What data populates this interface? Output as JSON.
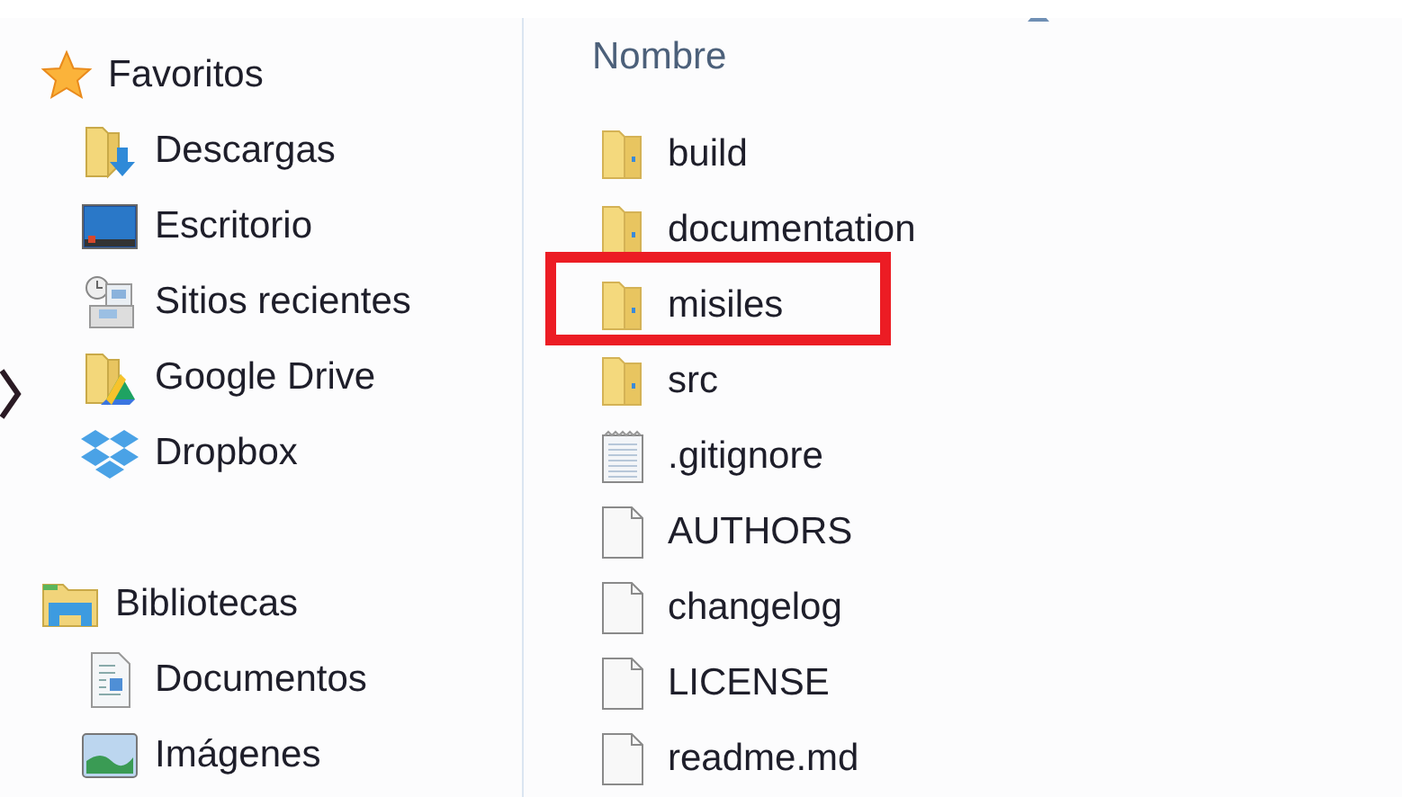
{
  "navigation": [
    {
      "label": "Favoritos",
      "kind": "star",
      "children": [
        {
          "label": "Descargas",
          "kind": "downloads"
        },
        {
          "label": "Escritorio",
          "kind": "desktop"
        },
        {
          "label": "Sitios recientes",
          "kind": "recent"
        },
        {
          "label": "Google Drive",
          "kind": "drive"
        },
        {
          "label": "Dropbox",
          "kind": "dropbox"
        }
      ]
    },
    {
      "label": "Bibliotecas",
      "kind": "library",
      "children": [
        {
          "label": "Documentos",
          "kind": "documents"
        },
        {
          "label": "Imágenes",
          "kind": "pictures"
        }
      ]
    }
  ],
  "file_list": {
    "column": {
      "label": "Nombre",
      "sorted": true
    },
    "items": [
      {
        "name": "build",
        "kind": "folder",
        "highlighted": false
      },
      {
        "name": "documentation",
        "kind": "folder",
        "highlighted": false
      },
      {
        "name": "misiles",
        "kind": "folder",
        "highlighted": true
      },
      {
        "name": "src",
        "kind": "folder",
        "highlighted": false
      },
      {
        "name": ".gitignore",
        "kind": "text",
        "highlighted": false
      },
      {
        "name": "AUTHORS",
        "kind": "file",
        "highlighted": false
      },
      {
        "name": "changelog",
        "kind": "file",
        "highlighted": false
      },
      {
        "name": "LICENSE",
        "kind": "file",
        "highlighted": false
      },
      {
        "name": "readme.md",
        "kind": "file",
        "highlighted": false
      }
    ]
  }
}
